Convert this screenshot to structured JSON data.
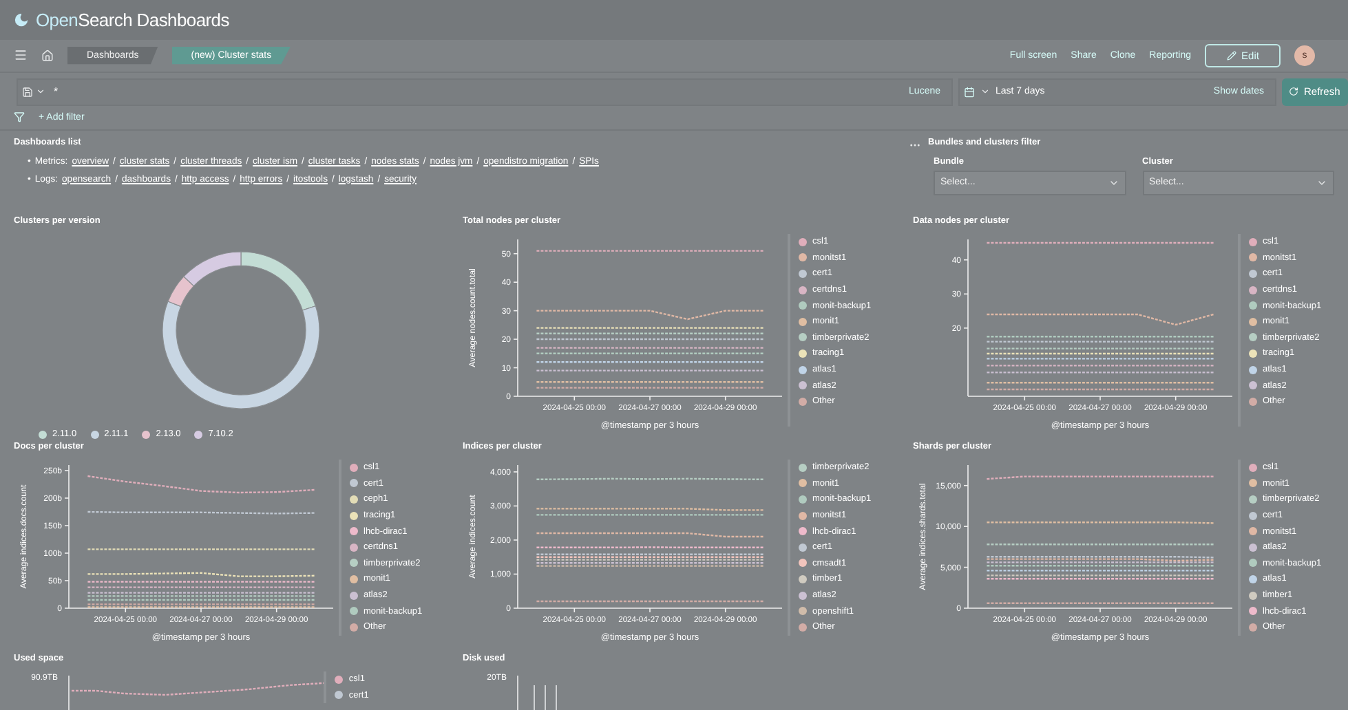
{
  "header": {
    "brand": [
      "Open",
      "Search Dashboards"
    ]
  },
  "nav": {
    "breadcrumbs": [
      {
        "label": "Dashboards",
        "selected": false
      },
      {
        "label": "(new) Cluster stats",
        "selected": true
      }
    ],
    "actions": [
      "Full screen",
      "Share",
      "Clone",
      "Reporting"
    ],
    "edit": "Edit",
    "avatar": "s"
  },
  "query": {
    "value": "*",
    "language": "Lucene",
    "time": "Last 7 days",
    "show_dates": "Show dates",
    "refresh": "Refresh",
    "add_filter": "+ Add filter"
  },
  "dashboards_list": {
    "title": "Dashboards list",
    "separator": "/",
    "bullet": "•",
    "groups": [
      {
        "label": "Metrics:",
        "links": [
          "overview",
          "cluster stats",
          "cluster threads",
          "cluster ism",
          "cluster tasks",
          "nodes stats",
          "nodes jvm",
          "opendistro migration",
          "SPIs"
        ]
      },
      {
        "label": "Logs:",
        "links": [
          "opensearch",
          "dashboards",
          "http access",
          "http errors",
          "itostools",
          "logstash",
          "security"
        ]
      }
    ]
  },
  "filter_panel": {
    "title": "Bundles and clusters filter",
    "controls": [
      {
        "label": "Bundle",
        "placeholder": "Select..."
      },
      {
        "label": "Cluster",
        "placeholder": "Select..."
      }
    ]
  },
  "panels": [
    {
      "title": "Clusters per version",
      "chart_data": {
        "type": "donut",
        "categories": [
          "2.11.0",
          "2.11.1",
          "2.13.0",
          "7.10.2"
        ],
        "values": [
          20,
          61,
          6,
          13
        ],
        "colors": [
          "#c3ddd5",
          "#c8d6e3",
          "#e6c3cd",
          "#d6cbe2"
        ]
      }
    },
    {
      "title": "Total nodes per cluster",
      "chart_data": {
        "type": "line",
        "xlabel": "@timestamp per 3 hours",
        "ylabel": "Average nodes.count.total",
        "categories": [
          null,
          "2024-04-25 00:00",
          null,
          "2024-04-27 00:00",
          null,
          "2024-04-29 00:00",
          null
        ],
        "ylim": [
          0,
          55
        ],
        "yticks": [
          0,
          10,
          20,
          30,
          40,
          50
        ],
        "series": [
          {
            "name": "csl1",
            "color": "#e0aebb",
            "line_style": "dashed",
            "values": [
              51,
              51,
              51,
              51,
              51,
              51,
              51
            ]
          },
          {
            "name": "monitst1",
            "color": "#e0b8a5",
            "line_style": "dashed",
            "values": [
              30,
              30,
              30,
              30,
              27,
              30,
              30
            ]
          },
          {
            "name": "cert1",
            "color": "#c0c8d2",
            "line_style": "dashed",
            "values": [
              20,
              20,
              20,
              20,
              20,
              20,
              20
            ]
          },
          {
            "name": "certdns1",
            "color": "#d8b5c4",
            "line_style": "dashed",
            "values": [
              17,
              17,
              17,
              17,
              17,
              17,
              17
            ]
          },
          {
            "name": "monit-backup1",
            "color": "#b0cbbf",
            "line_style": "dashed",
            "values": [
              15,
              15,
              15,
              15,
              15,
              15,
              15
            ]
          },
          {
            "name": "monit1",
            "color": "#e0bea2",
            "line_style": "dashed",
            "values": [
              5,
              5,
              5,
              5,
              5,
              5,
              5
            ]
          },
          {
            "name": "timberprivate2",
            "color": "#b6cec3",
            "line_style": "dashed",
            "values": [
              22,
              22,
              22,
              22,
              22,
              22,
              22
            ]
          },
          {
            "name": "tracing1",
            "color": "#ebe2b8",
            "line_style": "dashed",
            "values": [
              24,
              24,
              24,
              24,
              24,
              24,
              24
            ]
          },
          {
            "name": "atlas1",
            "color": "#c0d4e8",
            "line_style": "dashed",
            "values": [
              12,
              12,
              12,
              12,
              12,
              12,
              12
            ]
          },
          {
            "name": "atlas2",
            "color": "#cbc0d2",
            "line_style": "dashed",
            "values": [
              9,
              9,
              9,
              9,
              9,
              9,
              9
            ]
          },
          {
            "name": "Other",
            "color": "#d2aca6",
            "line_style": "dashed",
            "values": [
              3,
              3,
              3,
              3,
              3,
              3,
              3
            ]
          }
        ]
      }
    },
    {
      "title": "Data nodes per cluster",
      "chart_data": {
        "type": "line",
        "xlabel": "@timestamp per 3 hours",
        "categories": [
          null,
          "2024-04-25 00:00",
          null,
          "2024-04-27 00:00",
          null,
          "2024-04-29 00:00",
          null
        ],
        "ylim": [
          0,
          46
        ],
        "yticks": [
          20,
          30,
          40
        ],
        "series": [
          {
            "name": "csl1",
            "color": "#e0aebb",
            "line_style": "dashed",
            "values": [
              45,
              45,
              45,
              45,
              45,
              45,
              45
            ]
          },
          {
            "name": "monitst1",
            "color": "#e0b8a5",
            "line_style": "dashed",
            "values": [
              24,
              24,
              24,
              24,
              24,
              21,
              24
            ]
          },
          {
            "name": "cert1",
            "color": "#c0c8d2",
            "line_style": "dashed",
            "values": [
              16,
              16,
              16,
              16,
              16,
              16,
              16
            ]
          },
          {
            "name": "certdns1",
            "color": "#d8b5c4",
            "line_style": "dashed",
            "values": [
              9,
              9,
              9,
              9,
              9,
              9,
              9
            ]
          },
          {
            "name": "monit-backup1",
            "color": "#b0cbbf",
            "line_style": "dashed",
            "values": [
              17.5,
              17.5,
              17.5,
              17.5,
              17.5,
              17.5,
              17.5
            ]
          },
          {
            "name": "monit1",
            "color": "#e0bea2",
            "line_style": "dashed",
            "values": [
              4,
              4,
              4,
              4,
              4,
              4,
              4
            ]
          },
          {
            "name": "timberprivate2",
            "color": "#b6cec3",
            "line_style": "dashed",
            "values": [
              14,
              14,
              14,
              14,
              14,
              14,
              14
            ]
          },
          {
            "name": "tracing1",
            "color": "#ebe2b8",
            "line_style": "dashed",
            "values": [
              12.5,
              12.5,
              12.5,
              12.5,
              12.5,
              12.5,
              12.5
            ]
          },
          {
            "name": "atlas1",
            "color": "#c0d4e8",
            "line_style": "dashed",
            "values": [
              11,
              11,
              11,
              11,
              11,
              11,
              11
            ]
          },
          {
            "name": "atlas2",
            "color": "#cbc0d2",
            "line_style": "dashed",
            "values": [
              7,
              7,
              7,
              7,
              7,
              7,
              7
            ]
          },
          {
            "name": "Other",
            "color": "#d2aca6",
            "line_style": "dashed",
            "values": [
              2,
              2,
              2,
              2,
              2,
              2,
              2
            ]
          }
        ]
      }
    },
    {
      "title": "Docs per cluster",
      "chart_data": {
        "type": "line",
        "xlabel": "@timestamp per 3 hours",
        "ylabel": "Average indices.docs.count",
        "categories": [
          null,
          "2024-04-25 00:00",
          null,
          "2024-04-27 00:00",
          null,
          "2024-04-29 00:00",
          null
        ],
        "ylim": [
          0,
          260
        ],
        "yticks": [
          {
            "value": 0,
            "label": "0"
          },
          {
            "value": 50,
            "label": "50b"
          },
          {
            "value": 100,
            "label": "100b"
          },
          {
            "value": 150,
            "label": "150b"
          },
          {
            "value": 200,
            "label": "200b"
          },
          {
            "value": 250,
            "label": "250b"
          }
        ],
        "series": [
          {
            "name": "csl1",
            "color": "#e0aebb",
            "line_style": "dashed",
            "values": [
              240,
              230,
              222,
              213,
              210,
              211,
              215
            ]
          },
          {
            "name": "cert1",
            "color": "#c0c8d2",
            "line_style": "dashed",
            "values": [
              175,
              174,
              174,
              174,
              173,
              172,
              173
            ]
          },
          {
            "name": "ceph1",
            "color": "#e2dcb6",
            "line_style": "dashed",
            "values": [
              107,
              107,
              107,
              107,
              107,
              107,
              107
            ]
          },
          {
            "name": "tracing1",
            "color": "#ebe2b8",
            "line_style": "dashed",
            "values": [
              62,
              62,
              63,
              64,
              58,
              58,
              59
            ]
          },
          {
            "name": "lhcb-dirac1",
            "color": "#eebacb",
            "line_style": "dashed",
            "values": [
              48,
              48,
              48,
              48,
              48,
              48,
              48
            ]
          },
          {
            "name": "certdns1",
            "color": "#d8b5c4",
            "line_style": "dashed",
            "values": [
              38,
              38,
              38,
              38,
              38,
              38,
              38
            ]
          },
          {
            "name": "timberprivate2",
            "color": "#b6cec3",
            "line_style": "dashed",
            "values": [
              22,
              22,
              22,
              22,
              22,
              22,
              22
            ]
          },
          {
            "name": "monit1",
            "color": "#e0bea2",
            "line_style": "dashed",
            "values": [
              2,
              2,
              2,
              2,
              2,
              2,
              2
            ]
          },
          {
            "name": "atlas2",
            "color": "#cbc0d2",
            "line_style": "dashed",
            "values": [
              28,
              28,
              28,
              28,
              28,
              28,
              28
            ]
          },
          {
            "name": "monit-backup1",
            "color": "#b0cbbf",
            "line_style": "dashed",
            "values": [
              15,
              15,
              15,
              15,
              15,
              15,
              15
            ]
          },
          {
            "name": "Other",
            "color": "#d2aca6",
            "line_style": "dashed",
            "values": [
              7,
              7,
              7,
              7,
              7,
              7,
              7
            ]
          }
        ]
      }
    },
    {
      "title": "Indices per cluster",
      "chart_data": {
        "type": "line",
        "xlabel": "@timestamp per 3 hours",
        "ylabel": "Average indices.count",
        "categories": [
          null,
          "2024-04-25 00:00",
          null,
          "2024-04-27 00:00",
          null,
          "2024-04-29 00:00",
          null
        ],
        "ylim": [
          0,
          4200
        ],
        "yticks": [
          {
            "value": 0,
            "label": "0"
          },
          {
            "value": 1000,
            "label": "1,000"
          },
          {
            "value": 2000,
            "label": "2,000"
          },
          {
            "value": 3000,
            "label": "3,000"
          },
          {
            "value": 4000,
            "label": "4,000"
          }
        ],
        "series": [
          {
            "name": "timberprivate2",
            "color": "#b6cec3",
            "line_style": "dashed",
            "values": [
              3780,
              3790,
              3800,
              3790,
              3800,
              3790,
              3780
            ]
          },
          {
            "name": "monit1",
            "color": "#e0bea2",
            "line_style": "dashed",
            "values": [
              2920,
              2920,
              2920,
              2920,
              2920,
              2880,
              2880
            ]
          },
          {
            "name": "monit-backup1",
            "color": "#b0cbbf",
            "line_style": "dashed",
            "values": [
              2740,
              2740,
              2740,
              2740,
              2740,
              2740,
              2740
            ]
          },
          {
            "name": "monitst1",
            "color": "#e0b8a5",
            "line_style": "dashed",
            "values": [
              2200,
              2200,
              2200,
              2200,
              2200,
              2100,
              2100
            ]
          },
          {
            "name": "lhcb-dirac1",
            "color": "#eebacb",
            "line_style": "dashed",
            "values": [
              1780,
              1780,
              1780,
              1790,
              1780,
              1780,
              1780
            ]
          },
          {
            "name": "cert1",
            "color": "#c0c8d2",
            "line_style": "dashed",
            "values": [
              1580,
              1580,
              1580,
              1580,
              1580,
              1580,
              1580
            ]
          },
          {
            "name": "cmsadt1",
            "color": "#f2c4bc",
            "line_style": "dashed",
            "values": [
              1500,
              1500,
              1500,
              1500,
              1500,
              1500,
              1500
            ]
          },
          {
            "name": "timber1",
            "color": "#d0cbc0",
            "line_style": "dashed",
            "values": [
              1420,
              1420,
              1420,
              1420,
              1420,
              1420,
              1420
            ]
          },
          {
            "name": "atlas2",
            "color": "#cbc0d2",
            "line_style": "dashed",
            "values": [
              1330,
              1330,
              1330,
              1330,
              1330,
              1330,
              1330
            ]
          },
          {
            "name": "openshift1",
            "color": "#d0bcaa",
            "line_style": "dashed",
            "values": [
              1240,
              1240,
              1240,
              1240,
              1240,
              1240,
              1240
            ]
          },
          {
            "name": "Other",
            "color": "#d2aca6",
            "line_style": "dashed",
            "values": [
              200,
              200,
              200,
              200,
              200,
              200,
              200
            ]
          }
        ]
      }
    },
    {
      "title": "Shards per cluster",
      "chart_data": {
        "type": "line",
        "xlabel": "@timestamp per 3 hours",
        "ylabel": "Average indices.shards.total",
        "categories": [
          null,
          "2024-04-25 00:00",
          null,
          "2024-04-27 00:00",
          null,
          "2024-04-29 00:00",
          null
        ],
        "ylim": [
          0,
          17500
        ],
        "yticks": [
          {
            "value": 0,
            "label": "0"
          },
          {
            "value": 5000,
            "label": "5,000"
          },
          {
            "value": 10000,
            "label": "10,000"
          },
          {
            "value": 15000,
            "label": "15,000"
          }
        ],
        "series": [
          {
            "name": "csl1",
            "color": "#e0aebb",
            "line_style": "dashed",
            "values": [
              15800,
              16100,
              16100,
              16100,
              16100,
              16100,
              16100
            ]
          },
          {
            "name": "monit1",
            "color": "#e0bea2",
            "line_style": "dashed",
            "values": [
              10500,
              10500,
              10500,
              10500,
              10500,
              10500,
              10400
            ]
          },
          {
            "name": "timberprivate2",
            "color": "#b6cec3",
            "line_style": "dashed",
            "values": [
              7800,
              7800,
              7800,
              7800,
              7800,
              7800,
              7800
            ]
          },
          {
            "name": "cert1",
            "color": "#c0c8d2",
            "line_style": "dashed",
            "values": [
              6300,
              6300,
              6300,
              6300,
              6300,
              6300,
              6200
            ]
          },
          {
            "name": "monitst1",
            "color": "#e0b8a5",
            "line_style": "dashed",
            "values": [
              6000,
              6000,
              6000,
              6000,
              6000,
              5800,
              5900
            ]
          },
          {
            "name": "atlas2",
            "color": "#cbc0d2",
            "line_style": "dashed",
            "values": [
              5600,
              5600,
              5600,
              5600,
              5600,
              5600,
              5600
            ]
          },
          {
            "name": "monit-backup1",
            "color": "#b0cbbf",
            "line_style": "dashed",
            "values": [
              5200,
              5200,
              5200,
              5200,
              5200,
              5200,
              5200
            ]
          },
          {
            "name": "atlas1",
            "color": "#c0d4e8",
            "line_style": "dashed",
            "values": [
              4600,
              4600,
              4600,
              4600,
              4600,
              4600,
              4600
            ]
          },
          {
            "name": "timber1",
            "color": "#d0cbc0",
            "line_style": "dashed",
            "values": [
              4000,
              4000,
              4000,
              4000,
              4000,
              4000,
              4000
            ]
          },
          {
            "name": "lhcb-dirac1",
            "color": "#eebacb",
            "line_style": "dashed",
            "values": [
              3600,
              3600,
              3600,
              3600,
              3600,
              3600,
              3600
            ]
          },
          {
            "name": "Other",
            "color": "#d2aca6",
            "line_style": "dashed",
            "values": [
              600,
              600,
              600,
              600,
              600,
              600,
              600
            ]
          }
        ]
      }
    },
    {
      "title": "Used space",
      "top_tick": "90.9TB",
      "legend": [
        {
          "label": "csl1",
          "color": "#e0aebb"
        },
        {
          "label": "cert1",
          "color": "#c0c8d2"
        }
      ]
    },
    {
      "title": "Disk used",
      "top_tick": "20TB"
    }
  ]
}
